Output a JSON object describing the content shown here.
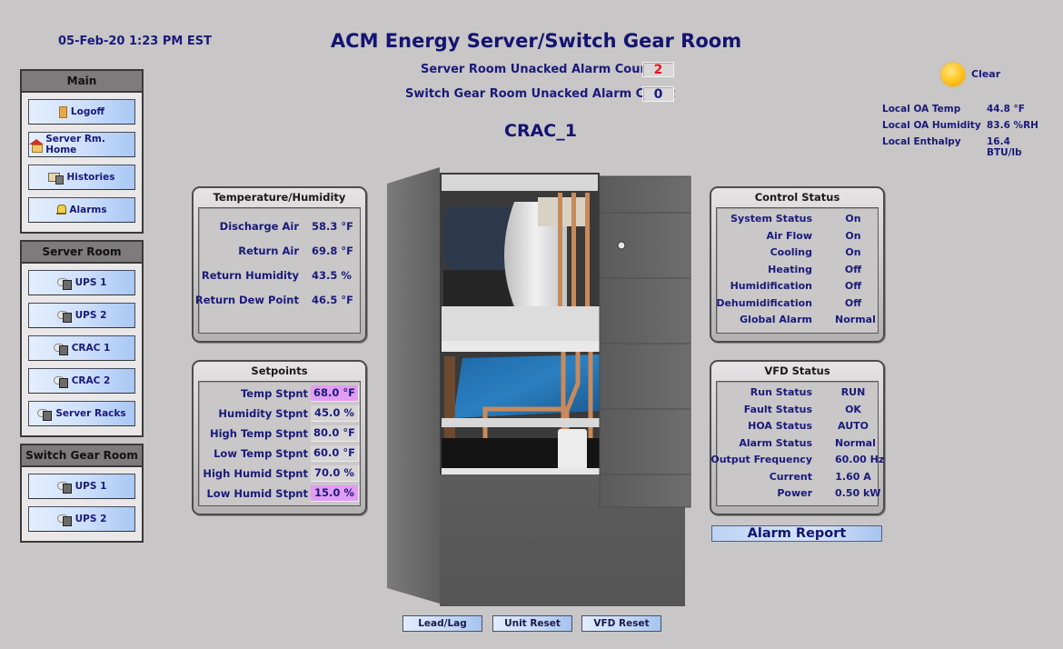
{
  "header": {
    "datetime": "05-Feb-20 1:23 PM EST",
    "title": "ACM Energy Server/Switch Gear Room",
    "unit_name": "CRAC_1",
    "alarm_counts": [
      {
        "label": "Server Room Unacked Alarm Count",
        "value": "2",
        "color": "#e0161b"
      },
      {
        "label": "Switch Gear Room Unacked Alarm Count",
        "value": "0",
        "color": "#1a1a7a"
      }
    ]
  },
  "weather": {
    "icon": "sun-icon",
    "condition": "Clear",
    "readings": [
      {
        "label": "Local OA Temp",
        "value": "44.8 °F"
      },
      {
        "label": "Local OA Humidity",
        "value": "83.6 %RH"
      },
      {
        "label": "Local Enthalpy",
        "value": "16.4 BTU/lb"
      }
    ]
  },
  "nav": {
    "main": {
      "title": "Main",
      "items": [
        {
          "label": "Logoff",
          "icon": "door-icon"
        },
        {
          "label": "Server Rm. Home",
          "icon": "house-icon"
        },
        {
          "label": "Histories",
          "icon": "histories-icon"
        },
        {
          "label": "Alarms",
          "icon": "bell-icon"
        }
      ]
    },
    "server_room": {
      "title": "Server Room",
      "items": [
        {
          "label": "UPS 1",
          "icon": "device-icon"
        },
        {
          "label": "UPS 2",
          "icon": "device-icon"
        },
        {
          "label": "CRAC 1",
          "icon": "device-icon"
        },
        {
          "label": "CRAC 2",
          "icon": "device-icon"
        },
        {
          "label": "Server Racks",
          "icon": "device-icon"
        }
      ]
    },
    "switch_gear_room": {
      "title": "Switch Gear Room",
      "items": [
        {
          "label": "UPS 1",
          "icon": "device-icon"
        },
        {
          "label": "UPS 2",
          "icon": "device-icon"
        }
      ]
    }
  },
  "temp_humidity": {
    "title": "Temperature/Humidity",
    "rows": [
      {
        "label": "Discharge Air",
        "value": "58.3 °F"
      },
      {
        "label": "Return Air",
        "value": "69.8 °F"
      },
      {
        "label": "Return Humidity",
        "value": "43.5 %"
      },
      {
        "label": "Return Dew Point",
        "value": "46.5 °F"
      }
    ]
  },
  "setpoints": {
    "title": "Setpoints",
    "highlight_color": "#e39cf3",
    "rows": [
      {
        "label": "Temp Stpnt",
        "value": "68.0 °F",
        "highlighted": true
      },
      {
        "label": "Humidity Stpnt",
        "value": "45.0 %",
        "highlighted": false
      },
      {
        "label": "High Temp Stpnt",
        "value": "80.0 °F",
        "highlighted": false
      },
      {
        "label": "Low Temp Stpnt",
        "value": "60.0 °F",
        "highlighted": false
      },
      {
        "label": "High Humid Stpnt",
        "value": "70.0 %",
        "highlighted": false
      },
      {
        "label": "Low Humid Stpnt",
        "value": "15.0 %",
        "highlighted": true
      }
    ]
  },
  "control_status": {
    "title": "Control Status",
    "rows": [
      {
        "label": "System Status",
        "value": "On"
      },
      {
        "label": "Air Flow",
        "value": "On"
      },
      {
        "label": "Cooling",
        "value": "On"
      },
      {
        "label": "Heating",
        "value": "Off"
      },
      {
        "label": "Humidification",
        "value": "Off"
      },
      {
        "label": "Dehumidification",
        "value": "Off"
      },
      {
        "label": "Global Alarm",
        "value": "Normal"
      }
    ]
  },
  "vfd_status": {
    "title": "VFD Status",
    "rows": [
      {
        "label": "Run Status",
        "value": "RUN"
      },
      {
        "label": "Fault Status",
        "value": "OK"
      },
      {
        "label": "HOA Status",
        "value": "AUTO"
      },
      {
        "label": "Alarm Status",
        "value": "Normal"
      },
      {
        "label": "Output Frequency",
        "value": "60.00 Hz"
      },
      {
        "label": "Current",
        "value": "1.60 A"
      },
      {
        "label": "Power",
        "value": "0.50 kW"
      }
    ]
  },
  "actions": {
    "alarm_report": "Alarm Report",
    "lead_lag": "Lead/Lag",
    "unit_reset": "Unit Reset",
    "vfd_reset": "VFD Reset"
  },
  "colors": {
    "background": "#c8c6c7",
    "text": "#1a1a7a",
    "alarm_red": "#e0161b",
    "button_blue": "#cfe0fb"
  }
}
